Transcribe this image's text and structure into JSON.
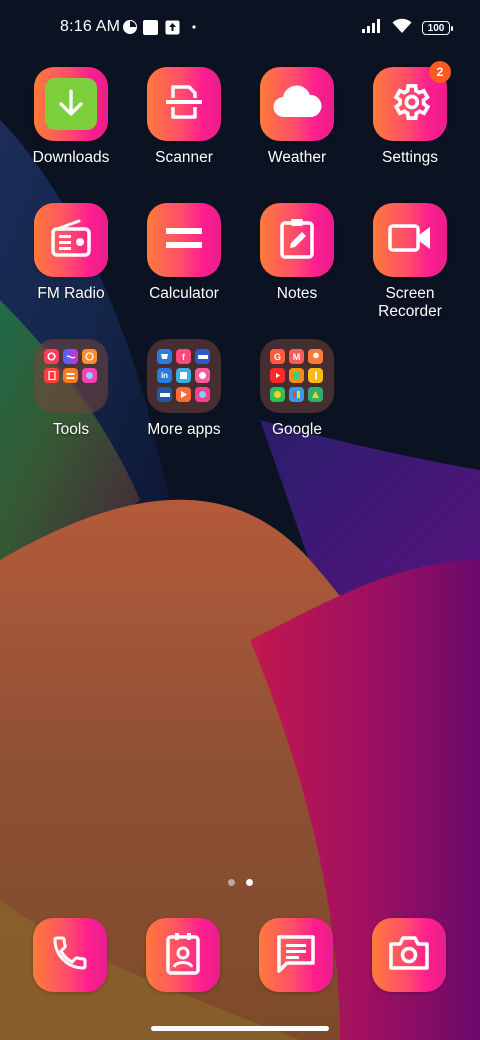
{
  "status_bar": {
    "time": "8:16 AM",
    "battery": "100",
    "icons": [
      "notification-app-icon",
      "square-notification-icon",
      "upload-notification-icon",
      "dot-icon",
      "signal-icon",
      "wifi-icon",
      "battery-icon"
    ]
  },
  "apps": [
    {
      "label": "Downloads",
      "icon": "download-icon"
    },
    {
      "label": "Scanner",
      "icon": "scanner-icon"
    },
    {
      "label": "Weather",
      "icon": "cloud-icon"
    },
    {
      "label": "Settings",
      "icon": "gear-icon",
      "badge": "2"
    },
    {
      "label": "FM Radio",
      "icon": "radio-icon"
    },
    {
      "label": "Calculator",
      "icon": "equals-icon"
    },
    {
      "label": "Notes",
      "icon": "note-edit-icon"
    },
    {
      "label": "Screen\nRecorder",
      "icon": "video-camera-icon"
    }
  ],
  "folders": [
    {
      "label": "Tools"
    },
    {
      "label": "More apps"
    },
    {
      "label": "Google"
    }
  ],
  "dock": [
    {
      "icon": "phone-icon"
    },
    {
      "icon": "contacts-icon"
    },
    {
      "icon": "messages-icon"
    },
    {
      "icon": "camera-icon"
    }
  ],
  "page_indicator": {
    "count": 2,
    "active": 2
  },
  "colors": {
    "icon_gradient_start": "#ff7a3a",
    "icon_gradient_end": "#ff1e8f",
    "download_green": "#7ccf3a",
    "badge": "#ff5a1f"
  }
}
